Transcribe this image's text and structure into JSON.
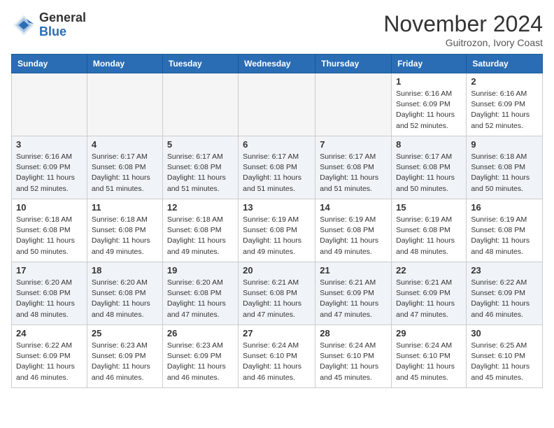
{
  "header": {
    "logo_general": "General",
    "logo_blue": "Blue",
    "month_title": "November 2024",
    "location": "Guitrozon, Ivory Coast"
  },
  "weekdays": [
    "Sunday",
    "Monday",
    "Tuesday",
    "Wednesday",
    "Thursday",
    "Friday",
    "Saturday"
  ],
  "weeks": [
    [
      {
        "day": "",
        "empty": true
      },
      {
        "day": "",
        "empty": true
      },
      {
        "day": "",
        "empty": true
      },
      {
        "day": "",
        "empty": true
      },
      {
        "day": "",
        "empty": true
      },
      {
        "day": "1",
        "sunrise": "Sunrise: 6:16 AM",
        "sunset": "Sunset: 6:09 PM",
        "daylight": "Daylight: 11 hours and 52 minutes."
      },
      {
        "day": "2",
        "sunrise": "Sunrise: 6:16 AM",
        "sunset": "Sunset: 6:09 PM",
        "daylight": "Daylight: 11 hours and 52 minutes."
      }
    ],
    [
      {
        "day": "3",
        "sunrise": "Sunrise: 6:16 AM",
        "sunset": "Sunset: 6:09 PM",
        "daylight": "Daylight: 11 hours and 52 minutes."
      },
      {
        "day": "4",
        "sunrise": "Sunrise: 6:17 AM",
        "sunset": "Sunset: 6:08 PM",
        "daylight": "Daylight: 11 hours and 51 minutes."
      },
      {
        "day": "5",
        "sunrise": "Sunrise: 6:17 AM",
        "sunset": "Sunset: 6:08 PM",
        "daylight": "Daylight: 11 hours and 51 minutes."
      },
      {
        "day": "6",
        "sunrise": "Sunrise: 6:17 AM",
        "sunset": "Sunset: 6:08 PM",
        "daylight": "Daylight: 11 hours and 51 minutes."
      },
      {
        "day": "7",
        "sunrise": "Sunrise: 6:17 AM",
        "sunset": "Sunset: 6:08 PM",
        "daylight": "Daylight: 11 hours and 51 minutes."
      },
      {
        "day": "8",
        "sunrise": "Sunrise: 6:17 AM",
        "sunset": "Sunset: 6:08 PM",
        "daylight": "Daylight: 11 hours and 50 minutes."
      },
      {
        "day": "9",
        "sunrise": "Sunrise: 6:18 AM",
        "sunset": "Sunset: 6:08 PM",
        "daylight": "Daylight: 11 hours and 50 minutes."
      }
    ],
    [
      {
        "day": "10",
        "sunrise": "Sunrise: 6:18 AM",
        "sunset": "Sunset: 6:08 PM",
        "daylight": "Daylight: 11 hours and 50 minutes."
      },
      {
        "day": "11",
        "sunrise": "Sunrise: 6:18 AM",
        "sunset": "Sunset: 6:08 PM",
        "daylight": "Daylight: 11 hours and 49 minutes."
      },
      {
        "day": "12",
        "sunrise": "Sunrise: 6:18 AM",
        "sunset": "Sunset: 6:08 PM",
        "daylight": "Daylight: 11 hours and 49 minutes."
      },
      {
        "day": "13",
        "sunrise": "Sunrise: 6:19 AM",
        "sunset": "Sunset: 6:08 PM",
        "daylight": "Daylight: 11 hours and 49 minutes."
      },
      {
        "day": "14",
        "sunrise": "Sunrise: 6:19 AM",
        "sunset": "Sunset: 6:08 PM",
        "daylight": "Daylight: 11 hours and 49 minutes."
      },
      {
        "day": "15",
        "sunrise": "Sunrise: 6:19 AM",
        "sunset": "Sunset: 6:08 PM",
        "daylight": "Daylight: 11 hours and 48 minutes."
      },
      {
        "day": "16",
        "sunrise": "Sunrise: 6:19 AM",
        "sunset": "Sunset: 6:08 PM",
        "daylight": "Daylight: 11 hours and 48 minutes."
      }
    ],
    [
      {
        "day": "17",
        "sunrise": "Sunrise: 6:20 AM",
        "sunset": "Sunset: 6:08 PM",
        "daylight": "Daylight: 11 hours and 48 minutes."
      },
      {
        "day": "18",
        "sunrise": "Sunrise: 6:20 AM",
        "sunset": "Sunset: 6:08 PM",
        "daylight": "Daylight: 11 hours and 48 minutes."
      },
      {
        "day": "19",
        "sunrise": "Sunrise: 6:20 AM",
        "sunset": "Sunset: 6:08 PM",
        "daylight": "Daylight: 11 hours and 47 minutes."
      },
      {
        "day": "20",
        "sunrise": "Sunrise: 6:21 AM",
        "sunset": "Sunset: 6:08 PM",
        "daylight": "Daylight: 11 hours and 47 minutes."
      },
      {
        "day": "21",
        "sunrise": "Sunrise: 6:21 AM",
        "sunset": "Sunset: 6:09 PM",
        "daylight": "Daylight: 11 hours and 47 minutes."
      },
      {
        "day": "22",
        "sunrise": "Sunrise: 6:21 AM",
        "sunset": "Sunset: 6:09 PM",
        "daylight": "Daylight: 11 hours and 47 minutes."
      },
      {
        "day": "23",
        "sunrise": "Sunrise: 6:22 AM",
        "sunset": "Sunset: 6:09 PM",
        "daylight": "Daylight: 11 hours and 46 minutes."
      }
    ],
    [
      {
        "day": "24",
        "sunrise": "Sunrise: 6:22 AM",
        "sunset": "Sunset: 6:09 PM",
        "daylight": "Daylight: 11 hours and 46 minutes."
      },
      {
        "day": "25",
        "sunrise": "Sunrise: 6:23 AM",
        "sunset": "Sunset: 6:09 PM",
        "daylight": "Daylight: 11 hours and 46 minutes."
      },
      {
        "day": "26",
        "sunrise": "Sunrise: 6:23 AM",
        "sunset": "Sunset: 6:09 PM",
        "daylight": "Daylight: 11 hours and 46 minutes."
      },
      {
        "day": "27",
        "sunrise": "Sunrise: 6:24 AM",
        "sunset": "Sunset: 6:10 PM",
        "daylight": "Daylight: 11 hours and 46 minutes."
      },
      {
        "day": "28",
        "sunrise": "Sunrise: 6:24 AM",
        "sunset": "Sunset: 6:10 PM",
        "daylight": "Daylight: 11 hours and 45 minutes."
      },
      {
        "day": "29",
        "sunrise": "Sunrise: 6:24 AM",
        "sunset": "Sunset: 6:10 PM",
        "daylight": "Daylight: 11 hours and 45 minutes."
      },
      {
        "day": "30",
        "sunrise": "Sunrise: 6:25 AM",
        "sunset": "Sunset: 6:10 PM",
        "daylight": "Daylight: 11 hours and 45 minutes."
      }
    ]
  ]
}
